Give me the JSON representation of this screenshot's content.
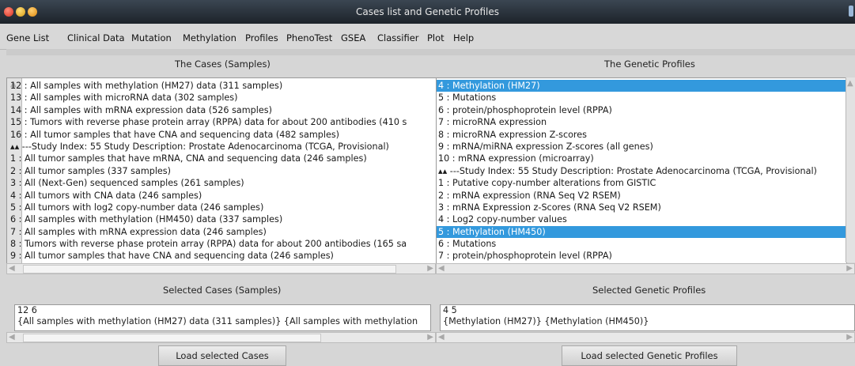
{
  "window": {
    "title": "Cases list and Genetic Profiles"
  },
  "menu": [
    "Gene List",
    "Clinical Data",
    "Mutation",
    "Methylation",
    "Profiles",
    "PhenoTest",
    "GSEA",
    "Classifier",
    "Plot",
    "Help"
  ],
  "cases_panel": {
    "label": "The Cases (Samples)",
    "items": [
      "12 : All samples with methylation (HM27) data (311 samples)",
      "13 : All samples with microRNA data (302 samples)",
      "14 : All samples with mRNA expression data (526 samples)",
      "15 : Tumors with reverse phase protein array (RPPA) data for about 200 antibodies (410 s",
      "16 : All tumor samples that have CNA and sequencing data (482 samples)",
      "▴▴ ---Study Index:  55   Study Description:  Prostate Adenocarcinoma (TCGA, Provisional)",
      "1 : All tumor samples that have mRNA, CNA and sequencing data (246 samples)",
      "2 : All tumor samples (337 samples)",
      "3 : All (Next-Gen) sequenced samples (261 samples)",
      "4 : All tumors with CNA data (246 samples)",
      "5 : All tumors with log2 copy-number data (246 samples)",
      "6 : All samples with methylation (HM450) data (337 samples)",
      "7 : All samples with mRNA expression data (246 samples)",
      "8 : Tumors with reverse phase protein array (RPPA) data for about 200 antibodies (165 sa",
      "9 : All tumor samples that have CNA and sequencing data (246 samples)"
    ]
  },
  "profiles_panel": {
    "label": "The Genetic Profiles",
    "items": [
      "4 : Methylation (HM27)",
      "5 : Mutations",
      "6 : protein/phosphoprotein level (RPPA)",
      "7 : microRNA expression",
      "8 : microRNA expression Z-scores",
      "9 : mRNA/miRNA expression Z-scores (all genes)",
      "10 : mRNA expression (microarray)",
      "▴▴ ---Study Index:  55   Study Description:  Prostate Adenocarcinoma (TCGA, Provisional)",
      "1 : Putative copy-number alterations from GISTIC",
      "2 : mRNA expression (RNA Seq V2 RSEM)",
      "3 : mRNA Expression z-Scores (RNA Seq V2 RSEM)",
      "4 : Log2 copy-number values",
      "5 : Methylation (HM450)",
      "6 : Mutations",
      "7 : protein/phosphoprotein level (RPPA)"
    ],
    "selected_indices": [
      0,
      12
    ]
  },
  "selected_cases": {
    "label": "Selected Cases (Samples)",
    "line1": "12 6",
    "line2": "{All samples with methylation (HM27) data (311 samples)} {All samples with methylation"
  },
  "selected_profiles": {
    "label": "Selected Genetic Profiles",
    "line1": "4 5",
    "line2": "{Methylation (HM27)} {Methylation (HM450)}"
  },
  "buttons": {
    "load_cases": "Load selected Cases",
    "load_profiles": "Load selected Genetic Profiles"
  },
  "colors": {
    "selection": "#3399dd",
    "titlebar": "#2a323b"
  }
}
